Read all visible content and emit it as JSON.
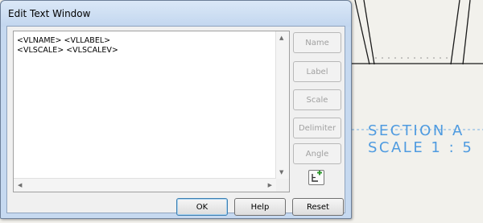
{
  "dialog": {
    "title": "Edit Text Window",
    "text_lines": [
      "<VLNAME> <VLLABEL>",
      "<VLSCALE> <VLSCALEV>"
    ],
    "side_buttons": [
      {
        "label": "Name",
        "enabled": false
      },
      {
        "label": "Label",
        "enabled": false
      },
      {
        "label": "Scale",
        "enabled": false
      },
      {
        "label": "Delimiter",
        "enabled": false
      },
      {
        "label": "Angle",
        "enabled": false
      }
    ],
    "add_icon": "add-text-icon",
    "buttons": {
      "ok": "OK",
      "help": "Help",
      "reset": "Reset"
    }
  },
  "drawing": {
    "section_line1": "SECTION A",
    "section_line2": "SCALE 1 : 5",
    "annotation_color": "#4f9be0"
  }
}
